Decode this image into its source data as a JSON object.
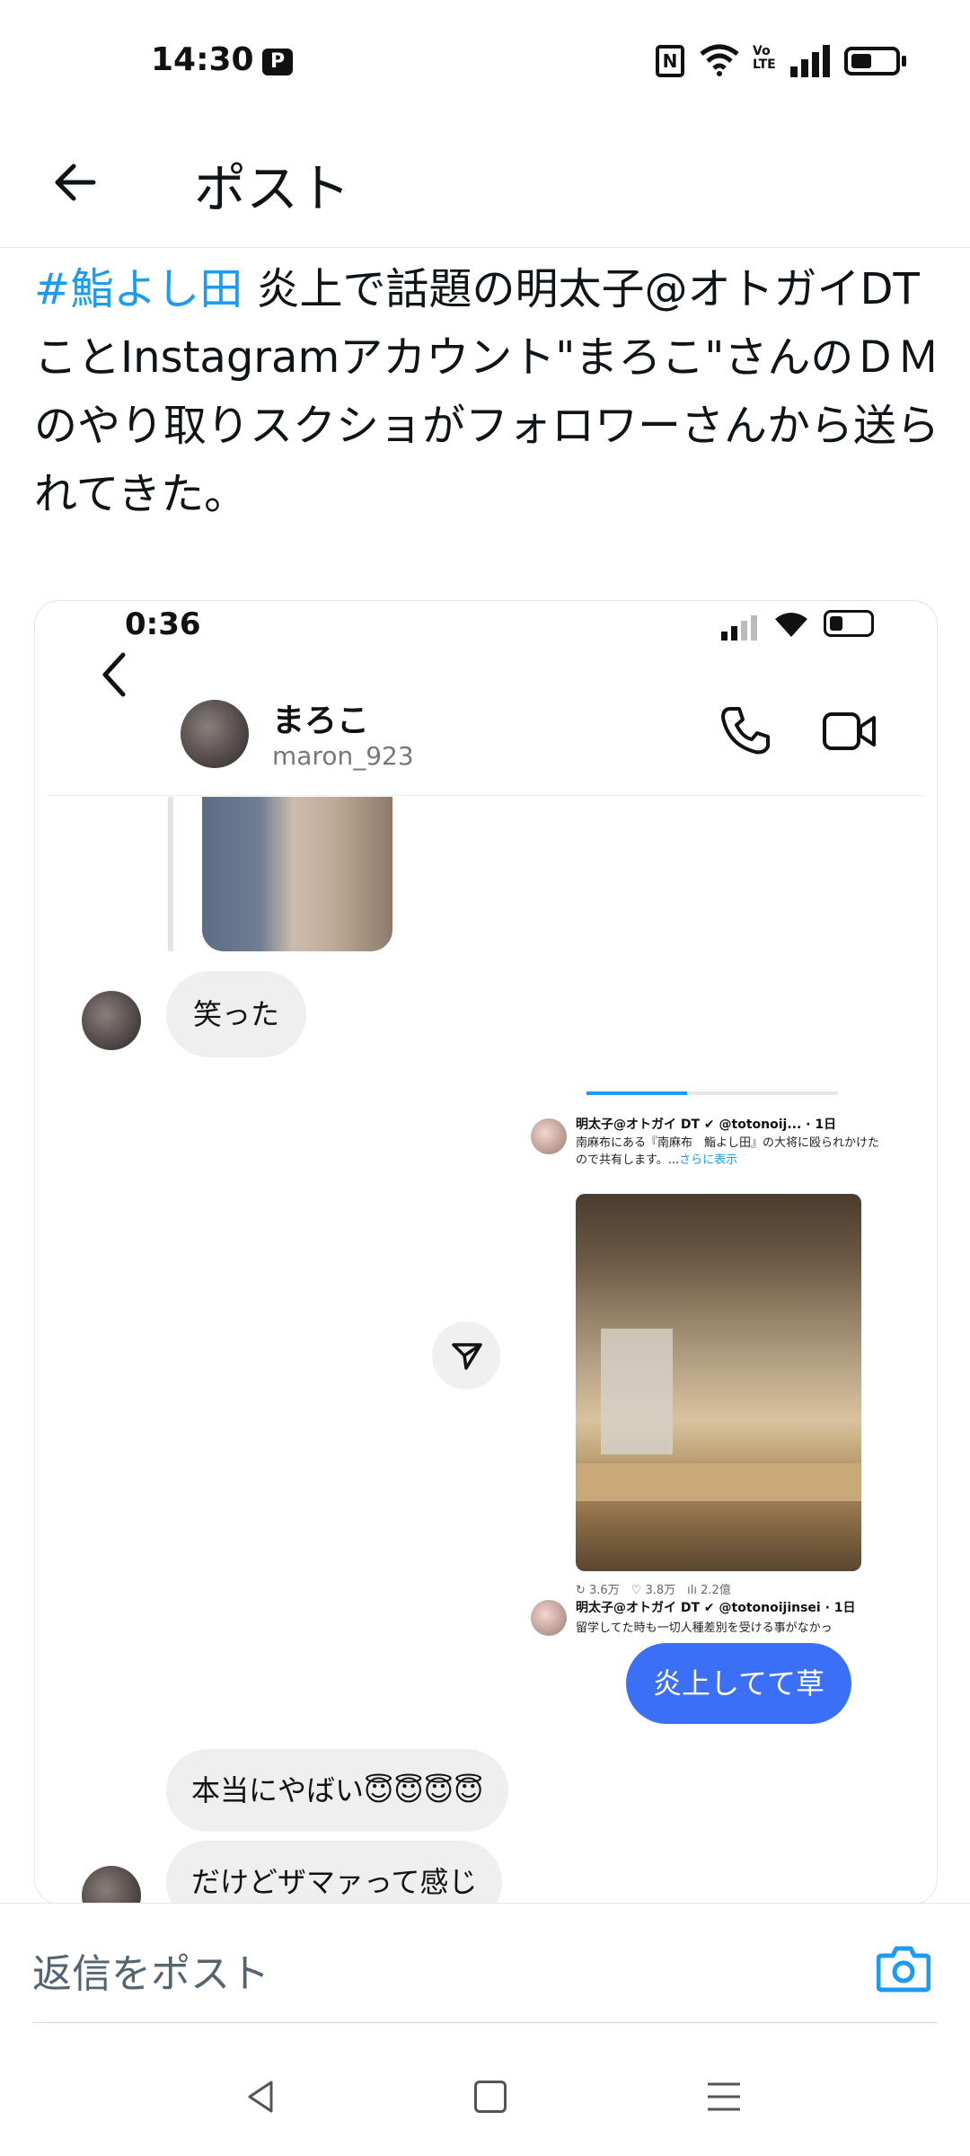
{
  "status_bar": {
    "time": "14:30",
    "volte": "Vo LTE"
  },
  "header": {
    "title": "ポスト"
  },
  "post": {
    "hashtag": "#鮨よし田",
    "text": " 炎上で話題の明太子@オトガイDTことInstagramアカウント\"まろこ\"さんのＤＭのやり取りスクショがフォロワーさんから送られてきた。"
  },
  "embedded_screenshot": {
    "time": "0:36",
    "chat_header": {
      "name": "まろこ",
      "handle": "maron_923"
    },
    "messages": {
      "laugh": "笑った",
      "sent": "炎上してて草",
      "received_1": "本当にやばい😇😇😇😇",
      "received_2": "だけどザマァって感じ"
    },
    "shared_tweet": {
      "name_1": "明太子@オトガイ DT ✔ @totonoij... · 1日",
      "text_1": "南麻布にある『南麻布　鮨よし田』の大将に殴られかけたので共有します。...",
      "more": "さらに表示",
      "stats": "↻ 3.6万　♡ 3.8万　ılı 2.2億",
      "name_2": "明太子@オトガイ DT ✔ @totonoijinsei · 1日",
      "text_2": "留学してた時も一切人種差別を受ける事がなかっ"
    }
  },
  "reply_bar": {
    "placeholder": "返信をポスト"
  }
}
